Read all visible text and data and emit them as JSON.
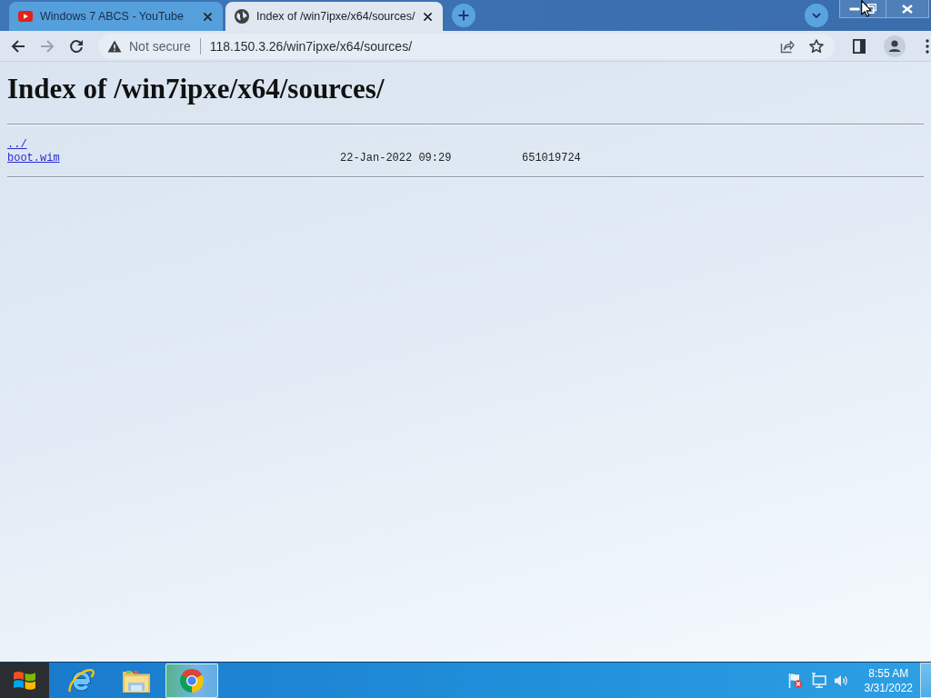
{
  "browser": {
    "tabs": [
      {
        "kind": "video",
        "title": "Windows 7 ABCS - YouTube",
        "selected": false
      },
      {
        "kind": "web",
        "title": "Index of /win7ipxe/x64/sources/",
        "selected": true
      }
    ]
  },
  "toolbar": {
    "nav_buttons": [
      {
        "kind": "back",
        "disabled": false
      },
      {
        "kind": "forward",
        "disabled": true
      },
      {
        "kind": "reload",
        "disabled": false
      }
    ],
    "security": "Not secure",
    "url": "118.150.3.26/win7ipxe/x64/sources/"
  },
  "page": {
    "heading": "Index of /win7ipxe/x64/sources/",
    "entries": [
      {
        "name": "../"
      },
      {
        "name": "boot.wim",
        "date": "22-Jan-2022 09:29",
        "size": "651019724"
      }
    ]
  },
  "taskbar": {
    "apps": [
      {
        "kind": "ie",
        "selected": false
      },
      {
        "kind": "folder",
        "selected": false
      },
      {
        "kind": "chrome",
        "selected": true
      }
    ],
    "clock": {
      "time": "8:55 AM",
      "date": "3/31/2022"
    }
  }
}
